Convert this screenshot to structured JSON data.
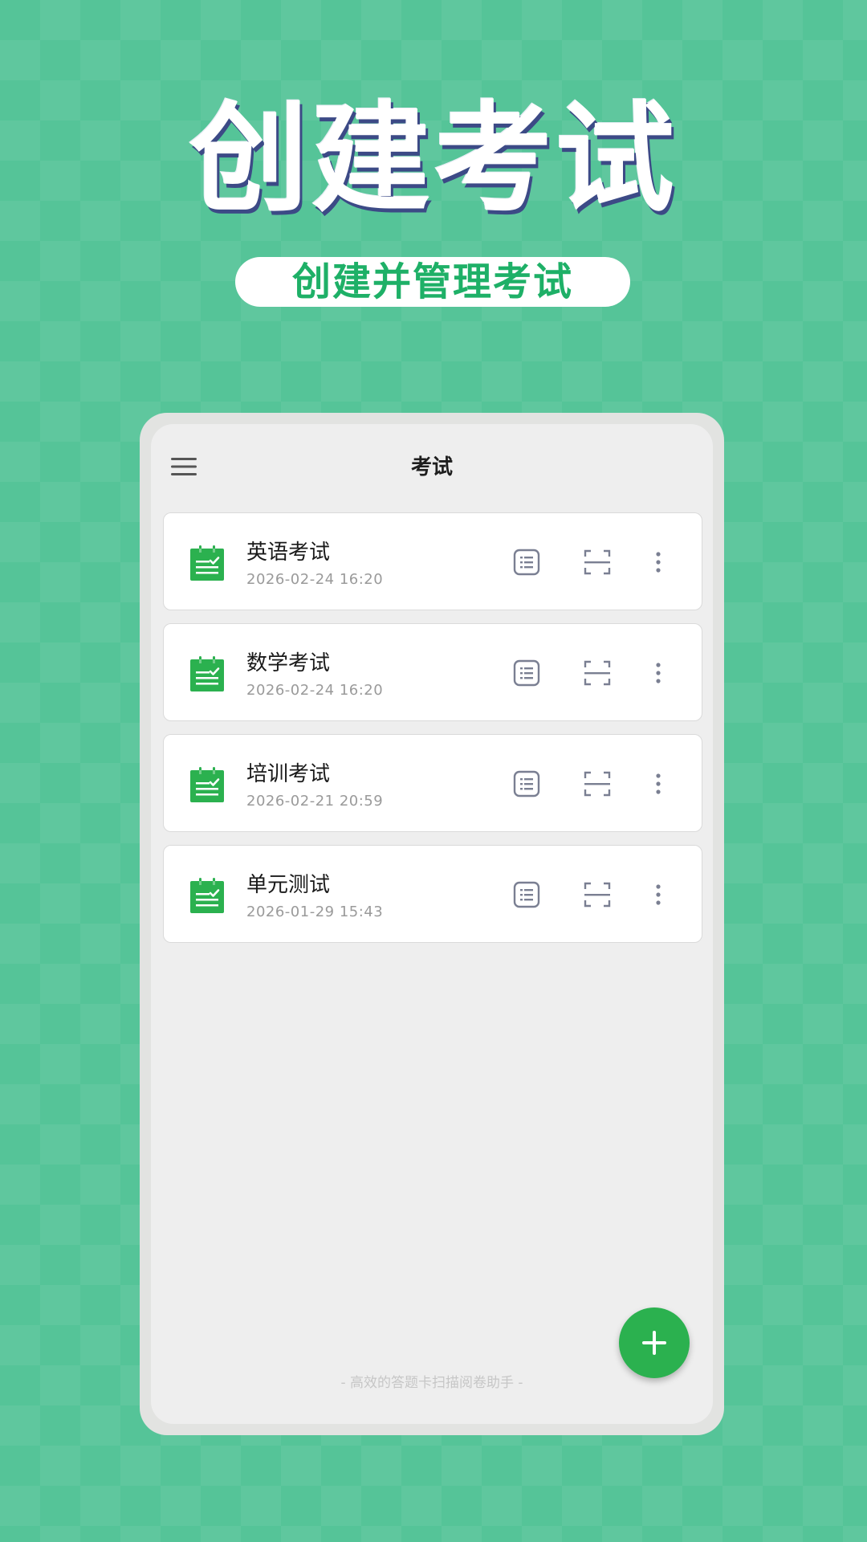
{
  "hero": {
    "title": "创建考试",
    "subtitle": "创建并管理考试"
  },
  "app": {
    "title": "考试",
    "menu_icon": "menu-icon",
    "footer": "- 高效的答题卡扫描阅卷助手 -"
  },
  "exams": [
    {
      "name": "英语考试",
      "date": "2026-02-24 16:20"
    },
    {
      "name": "数学考试",
      "date": "2026-02-24 16:20"
    },
    {
      "name": "培训考试",
      "date": "2026-02-21 20:59"
    },
    {
      "name": "单元测试",
      "date": "2026-01-29 15:43"
    }
  ],
  "row_icons": {
    "exam": "clipboard-check-icon",
    "sheet": "answer-sheet-icon",
    "scan": "scan-icon",
    "more": "more-vertical-icon"
  },
  "fab_icon": "plus-icon",
  "colors": {
    "background": "#55c498",
    "accent_green": "#2bb14f",
    "subtitle_text": "#1eb067",
    "title_shadow": "#3c4a86",
    "icon_gray": "#7a7f92"
  }
}
